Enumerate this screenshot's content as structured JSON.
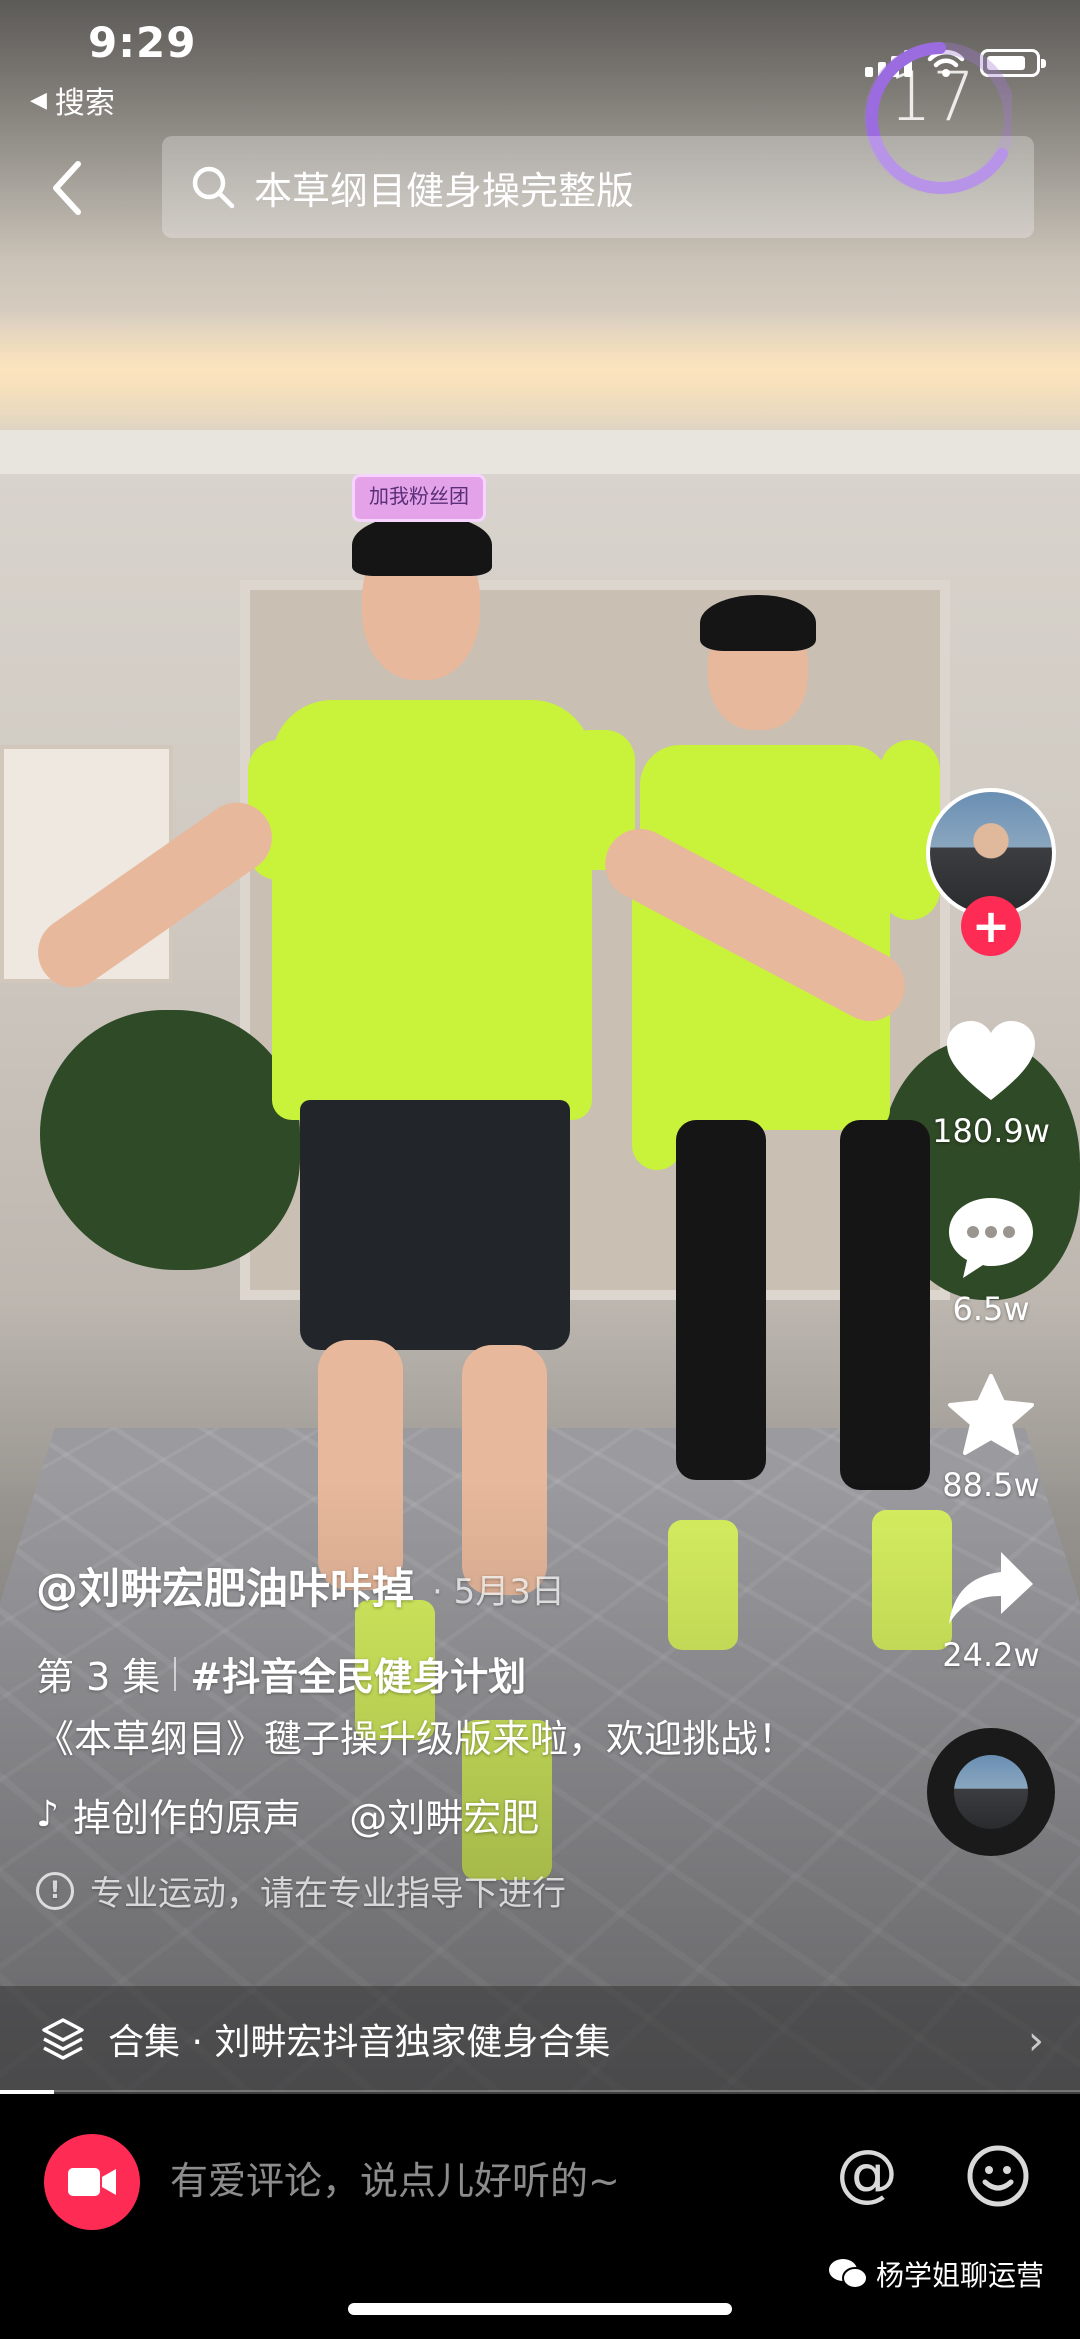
{
  "status_bar": {
    "time": "9:29",
    "back_app": "搜索"
  },
  "timer": {
    "value": "17"
  },
  "search": {
    "query": "本草纲目健身操完整版"
  },
  "video": {
    "sticker_text": "加我粉丝团"
  },
  "side_actions": {
    "likes": "180.9w",
    "comments": "6.5w",
    "favorites": "88.5w",
    "shares": "24.2w",
    "follow_symbol": "+"
  },
  "info": {
    "author": "@刘畊宏肥油咔咔掉",
    "date": "· 5月3日",
    "episode": "第 3 集",
    "hashtag": "#抖音全民健身计划",
    "description": "《本草纲目》毽子操升级版来啦，欢迎挑战！",
    "music": "掉创作的原声    @刘畊宏肥",
    "music_icon": "♪",
    "warning": "专业运动，请在专业指导下进行"
  },
  "collection": {
    "label": "合集 · 刘畊宏抖音独家健身合集",
    "chevron": "›"
  },
  "progress": {
    "fraction": 0.05
  },
  "comment_bar": {
    "placeholder": "有爱评论，说点儿好听的~",
    "at_symbol": "@"
  },
  "watermark": {
    "text": "杨学姐聊运营"
  },
  "colors": {
    "accent": "#fe2c55",
    "shirt": "#c9f23a"
  },
  "icons": [
    "back-chevron-icon",
    "search-icon",
    "heart-icon",
    "comment-icon",
    "star-icon",
    "share-icon",
    "music-note-icon",
    "warning-icon",
    "layers-icon",
    "camera-icon",
    "at-icon",
    "emoji-icon",
    "wechat-icon"
  ]
}
